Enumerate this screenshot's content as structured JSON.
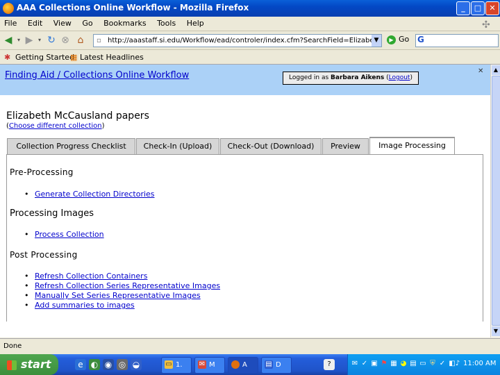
{
  "window": {
    "title": "AAA Collections Online Workflow - Mozilla Firefox"
  },
  "menu": [
    "File",
    "Edit",
    "View",
    "Go",
    "Bookmarks",
    "Tools",
    "Help"
  ],
  "navigation": {
    "url": "http://aaastaff.si.edu/Workflow/ead/controler/index.cfm?SearchField=Elizabeth+McCa",
    "go_label": "Go",
    "search_logo": "G"
  },
  "bookmarks": [
    "Getting Started",
    "Latest Headlines"
  ],
  "page": {
    "header_title": "Finding Aid / Collections Online Workflow",
    "login_prefix": "Logged in as",
    "login_user": "Barbara Aikens",
    "logout_open": "(",
    "logout_label": "Logout",
    "logout_close": ")",
    "close_glyph": "✕",
    "collection_title": "Elizabeth McCausland papers",
    "change_open": "(",
    "change_label": "Choose different collection",
    "change_close": ")",
    "tabs": [
      "Collection Progress Checklist",
      "Check-In (Upload)",
      "Check-Out (Download)",
      "Preview",
      "Image Processing"
    ],
    "sections": {
      "pre": {
        "heading": "Pre-Processing",
        "links": [
          "Generate Collection Directories"
        ]
      },
      "processing": {
        "heading": "Processing Images",
        "links": [
          "Process Collection"
        ]
      },
      "post": {
        "heading": "Post Processing",
        "links": [
          "Refresh Collection Containers",
          "Refresh Collection Series Representative Images",
          "Manually Set Series Representative Images",
          "Add summaries to images"
        ]
      }
    }
  },
  "status": {
    "text": "Done"
  },
  "taskbar": {
    "start_label": "start",
    "tasks": [
      "1.",
      "M",
      "A",
      "D"
    ],
    "clock": "11:00 AM"
  }
}
